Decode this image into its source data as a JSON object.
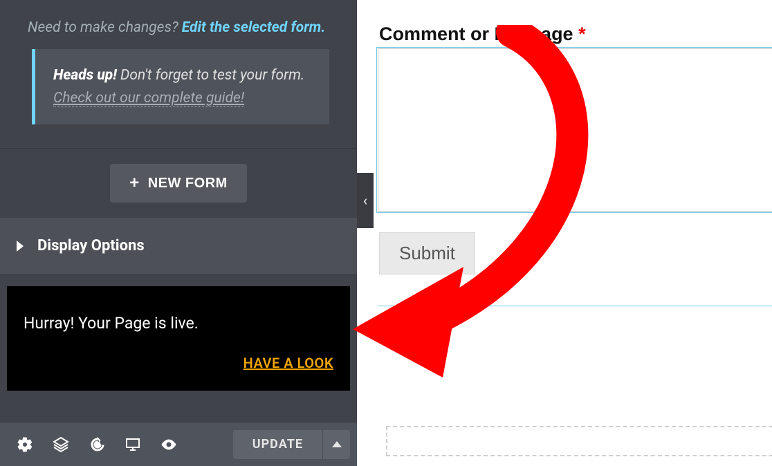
{
  "help": {
    "prompt": "Need to make changes?",
    "edit_link": "Edit the selected form."
  },
  "notice": {
    "heads": "Heads up!",
    "body": "Don't forget to test your form.",
    "guide": "Check out our complete guide!"
  },
  "new_form_label": "NEW FORM",
  "display_options_label": "Display Options",
  "live": {
    "msg": "Hurray! Your Page is live.",
    "look": "HAVE A LOOK"
  },
  "update_label": "UPDATE",
  "form": {
    "label": "Comment or Message",
    "required": "*",
    "submit": "Submit"
  }
}
